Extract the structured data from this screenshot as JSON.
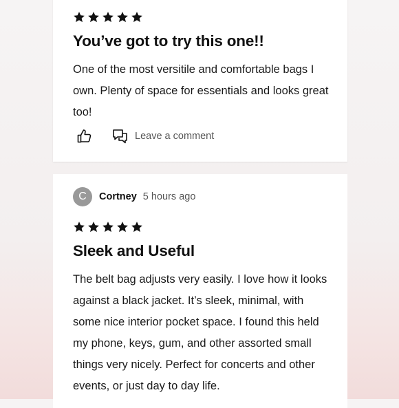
{
  "reviews": [
    {
      "rating": 5,
      "title": "You’ve got to try this one!!",
      "body": "One of the most versitile and comfortable bags I own. Plenty of space for essentials and looks great too!",
      "like_icon": "thumbs-up-icon",
      "comment_icon": "comment-bubbles-icon",
      "comment_label": "Leave a comment"
    },
    {
      "reviewer": {
        "initial": "C",
        "name": "Cortney",
        "time": "5 hours ago"
      },
      "rating": 5,
      "title": "Sleek and Useful",
      "body": "The belt bag adjusts very easily. I love how it looks against a black jacket. It’s sleek, minimal, with some nice interior pocket space. I found this held my phone, keys, gum, and other assorted small things very nicely. Perfect for concerts and other events, or just day to day life."
    }
  ],
  "colors": {
    "avatar_bg": "#999999",
    "star": "#111111",
    "muted_text": "#555555"
  }
}
